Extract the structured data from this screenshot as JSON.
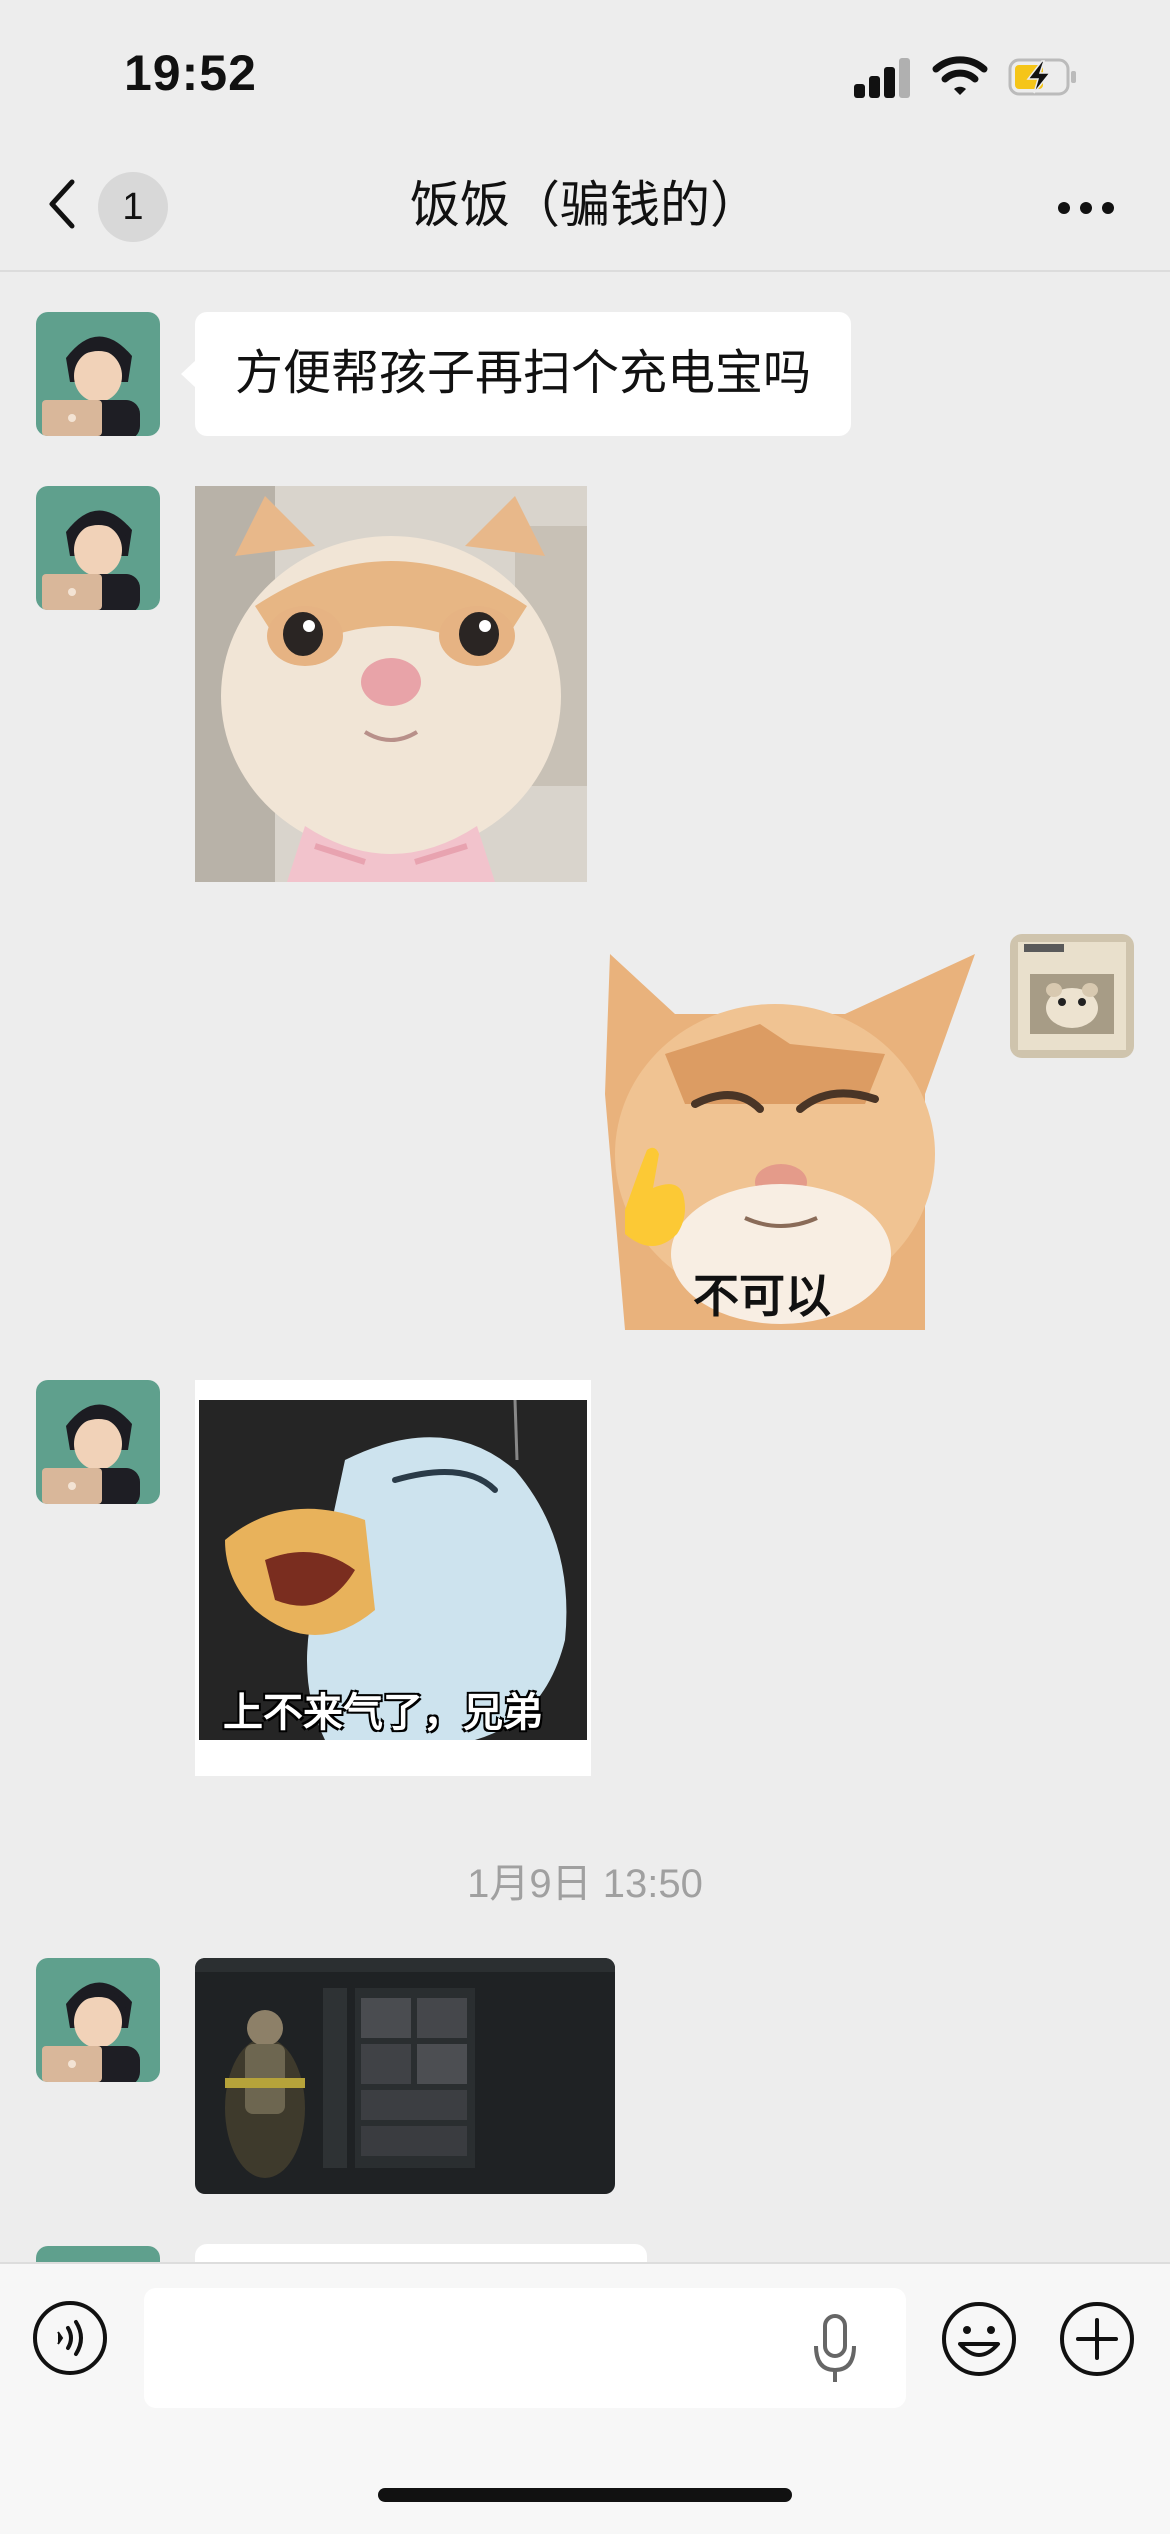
{
  "status_bar": {
    "time": "19:52"
  },
  "nav": {
    "unread_count": "1",
    "title": "饭饭（骗钱的）"
  },
  "messages": [
    {
      "sender": "contact",
      "type": "text",
      "text": "方便帮孩子再扫个充电宝吗"
    },
    {
      "sender": "contact",
      "type": "image"
    },
    {
      "sender": "self",
      "type": "sticker",
      "caption": "不可以"
    },
    {
      "sender": "contact",
      "type": "sticker",
      "caption": "上不来气了，兄弟"
    },
    {
      "type": "timestamp",
      "text": "1月9日 13:50"
    },
    {
      "sender": "contact",
      "type": "image"
    }
  ],
  "colors": {
    "background": "#ededed",
    "bubble": "#ffffff",
    "timestamp": "#a0a0a0",
    "battery_charge": "#f5c518"
  },
  "icons": {
    "back": "chevron-left-icon",
    "more": "ellipsis-icon",
    "voice": "voice-icon",
    "mic": "microphone-icon",
    "emoji": "emoji-icon",
    "plus": "plus-icon"
  }
}
